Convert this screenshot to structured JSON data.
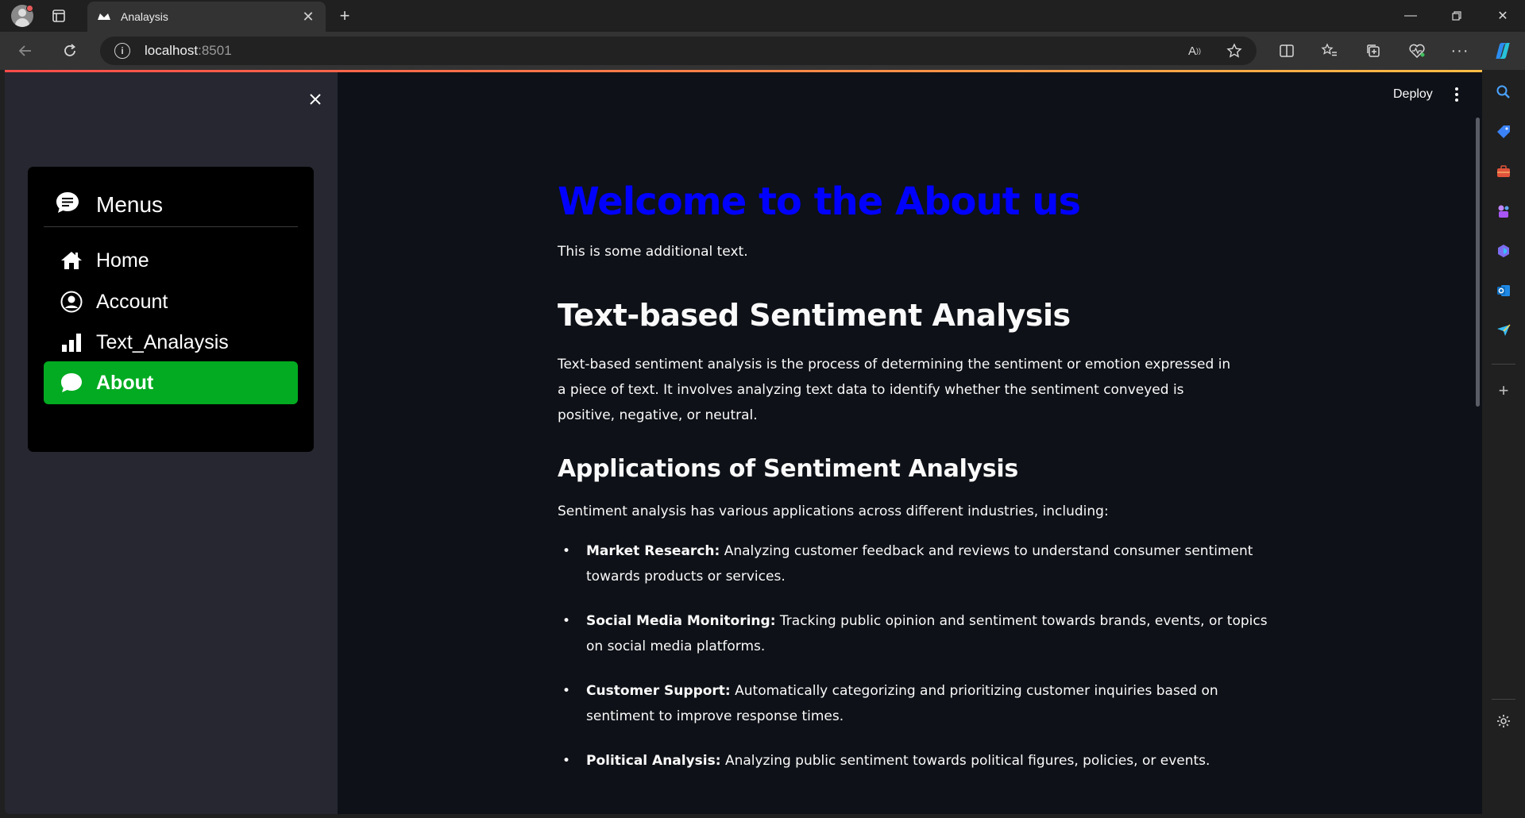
{
  "browser": {
    "tab_title": "Analaysis",
    "url_host": "localhost",
    "url_port": ":8501"
  },
  "sidebar": {
    "menu_title": "Menus",
    "items": [
      {
        "label": "Home",
        "icon": "house-icon"
      },
      {
        "label": "Account",
        "icon": "person-circle-icon"
      },
      {
        "label": "Text_Analaysis",
        "icon": "bar-chart-icon"
      },
      {
        "label": "About",
        "icon": "chat-bubble-icon",
        "active": true
      }
    ]
  },
  "header": {
    "deploy_label": "Deploy"
  },
  "content": {
    "title": "Welcome to the About us",
    "intro": "This is some additional text.",
    "section_title": "Text-based Sentiment Analysis",
    "section_paragraph": "Text-based sentiment analysis is the process of determining the sentiment or emotion expressed in a piece of text. It involves analyzing text data to identify whether the sentiment conveyed is positive, negative, or neutral.",
    "apps_title": "Applications of Sentiment Analysis",
    "apps_intro": "Sentiment analysis has various applications across different industries, including:",
    "apps": [
      {
        "term": "Market Research:",
        "desc": " Analyzing customer feedback and reviews to understand consumer sentiment towards products or services."
      },
      {
        "term": "Social Media Monitoring:",
        "desc": " Tracking public opinion and sentiment towards brands, events, or topics on social media platforms."
      },
      {
        "term": "Customer Support:",
        "desc": " Automatically categorizing and prioritizing customer inquiries based on sentiment to improve response times."
      },
      {
        "term": "Political Analysis:",
        "desc": " Analyzing public sentiment towards political figures, policies, or events."
      }
    ]
  },
  "colors": {
    "title_blue": "#0000ff",
    "active_menu_green": "#02ab21",
    "page_bg": "#0e1117",
    "sidebar_bg": "#262730"
  }
}
